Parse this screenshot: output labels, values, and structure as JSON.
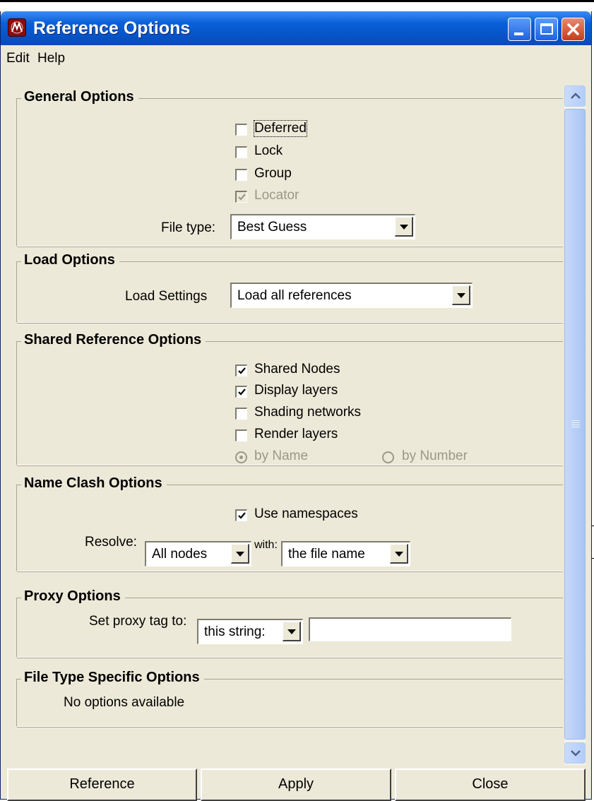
{
  "window": {
    "title": "Reference Options"
  },
  "menu": {
    "items": [
      "Edit",
      "Help"
    ]
  },
  "general_options": {
    "heading": "General Options",
    "checkboxes": [
      {
        "label": "Deferred",
        "checked": false,
        "enabled": true
      },
      {
        "label": "Lock",
        "checked": false,
        "enabled": true
      },
      {
        "label": "Group",
        "checked": false,
        "enabled": true
      },
      {
        "label": "Locator",
        "checked": true,
        "enabled": false
      }
    ],
    "file_type_label": "File type:",
    "file_type_value": "Best Guess"
  },
  "load_options": {
    "heading": "Load Options",
    "load_settings_label": "Load Settings",
    "load_settings_value": "Load all references"
  },
  "shared_reference_options": {
    "heading": "Shared Reference Options",
    "checkboxes": [
      {
        "label": "Shared Nodes",
        "checked": true
      },
      {
        "label": "Display layers",
        "checked": true
      },
      {
        "label": "Shading networks",
        "checked": false
      },
      {
        "label": "Render layers",
        "checked": false
      }
    ],
    "radios": [
      {
        "label": "by Name",
        "selected": true,
        "enabled": false
      },
      {
        "label": "by Number",
        "selected": false,
        "enabled": false
      }
    ]
  },
  "name_clash_options": {
    "heading": "Name Clash Options",
    "use_namespaces_label": "Use namespaces",
    "use_namespaces_checked": true,
    "resolve_label": "Resolve:",
    "resolve_value": "All nodes",
    "with_label": "with:",
    "with_value": "the file name"
  },
  "proxy_options": {
    "heading": "Proxy Options",
    "set_proxy_label": "Set proxy tag to:",
    "proxy_mode_value": "this string:",
    "proxy_tag_value": ""
  },
  "file_type_specific_options": {
    "heading": "File Type Specific Options",
    "message": "No options available"
  },
  "buttons": {
    "reference": "Reference",
    "apply": "Apply",
    "close": "Close"
  },
  "background_fragments": [
    "p",
    "."
  ]
}
